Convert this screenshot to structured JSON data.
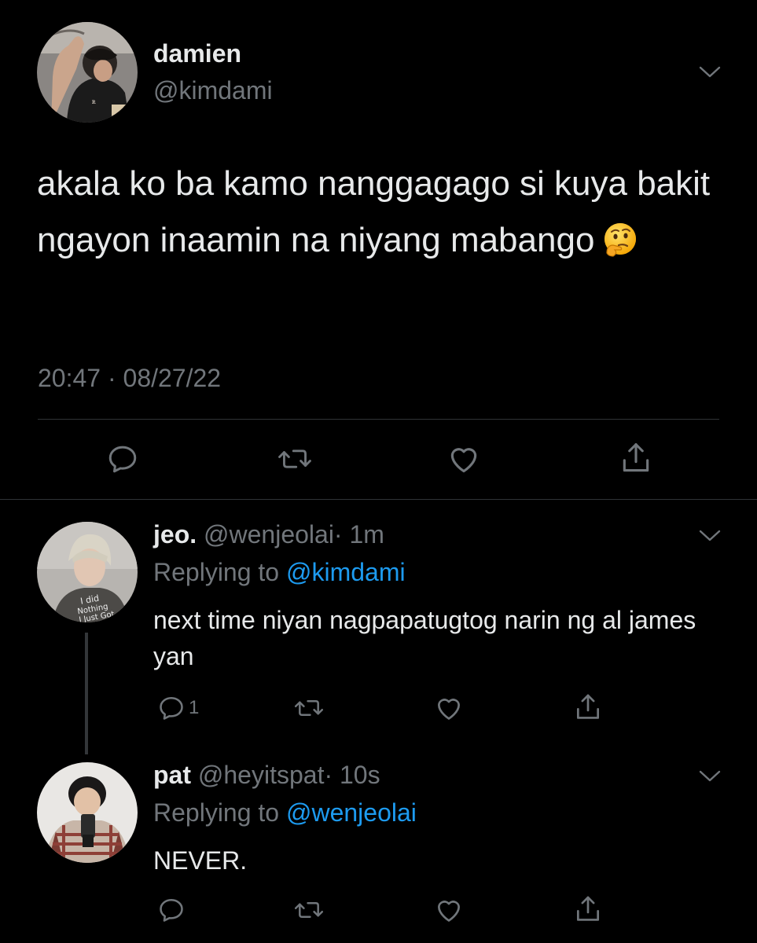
{
  "main_tweet": {
    "name": "damien",
    "handle": "@kimdami",
    "text": "akala ko ba kamo nanggagago si kuya bakit ngayon inaamin na niyang mabango",
    "emoji": "🤔",
    "timestamp": "20:47 · 08/27/22"
  },
  "replies": [
    {
      "name": "jeo.",
      "handle": "@wenjeolai",
      "time": "· 1m",
      "replying_label": "Replying to",
      "replying_to": "@kimdami",
      "text": "next time niyan nagpapatugtog narin ng al james yan",
      "reply_count": "1"
    },
    {
      "name": "pat",
      "handle": "@heyitspat",
      "time": "· 10s",
      "replying_label": "Replying to",
      "replying_to": "@wenjeolai",
      "text": "NEVER.",
      "reply_count": ""
    }
  ],
  "icons": {
    "reply": "reply-icon",
    "retweet": "retweet-icon",
    "like": "heart-icon",
    "share": "share-icon",
    "more": "chevron-down-icon"
  },
  "colors": {
    "background": "#000000",
    "text": "#e7e9ea",
    "muted": "#71767b",
    "link": "#1d9bf0",
    "divider": "#2f3336"
  }
}
